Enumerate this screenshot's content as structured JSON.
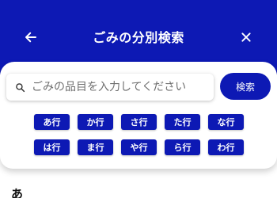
{
  "header": {
    "title": "ごみの分別検索",
    "back_icon": "arrow-left-icon",
    "close_icon": "close-icon",
    "background": "#0d19b4"
  },
  "search": {
    "placeholder": "ごみの品目を入力してください",
    "value": "",
    "button_label": "検索",
    "icon": "search-icon"
  },
  "kana_rows": [
    "あ行",
    "か行",
    "さ行",
    "た行",
    "な行",
    "は行",
    "ま行",
    "や行",
    "ら行",
    "わ行"
  ],
  "list": {
    "section_heading": "あ"
  }
}
